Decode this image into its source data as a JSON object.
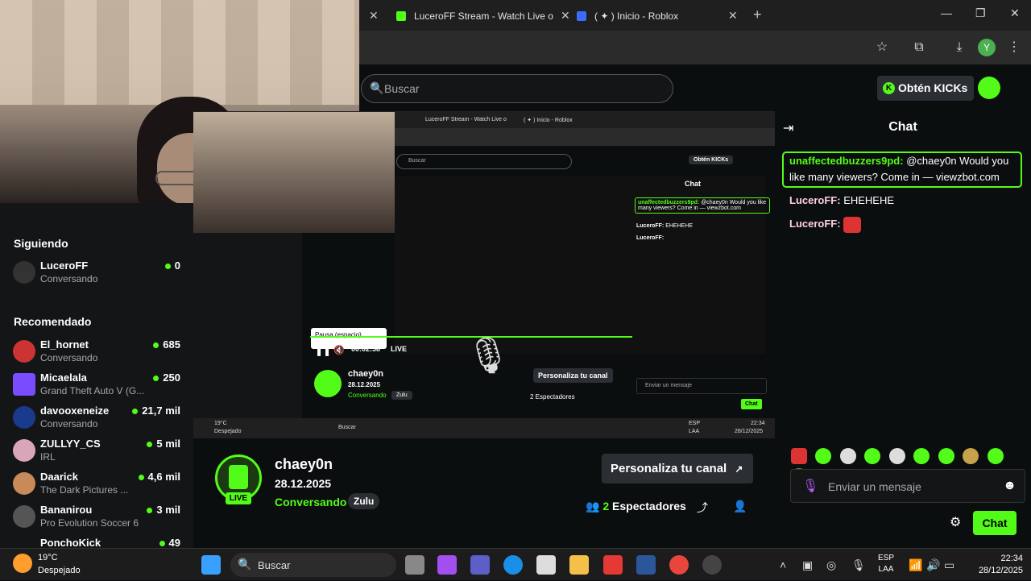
{
  "browser": {
    "tabs": [
      {
        "title": "LuceroFF Stream - Watch Live o",
        "color": "#53fc18"
      },
      {
        "title": "( ✦ ) Inicio - Roblox",
        "color": "#3d6bff"
      }
    ],
    "new_tab": "+",
    "profile_initial": "Y"
  },
  "header": {
    "search_placeholder": "Buscar",
    "kicks_label": "Obtén KICKs"
  },
  "sidebar": {
    "following_title": "Siguiendo",
    "following": [
      {
        "name": "LuceroFF",
        "sub": "Conversando",
        "count": "0"
      }
    ],
    "recommended_title": "Recomendado",
    "recommended": [
      {
        "name": "El_hornet",
        "sub": "Conversando",
        "count": "685"
      },
      {
        "name": "Micaelala",
        "sub": "Grand Theft Auto V (G...",
        "count": "250"
      },
      {
        "name": "davooxeneize",
        "sub": "Conversando",
        "count": "21,7 mil"
      },
      {
        "name": "ZULLYY_CS",
        "sub": "IRL",
        "count": "5 mil"
      },
      {
        "name": "Daarick",
        "sub": "The Dark Pictures ...",
        "count": "4,6 mil"
      },
      {
        "name": "Bananirou",
        "sub": "Pro Evolution Soccer 6",
        "count": "3 mil"
      },
      {
        "name": "PonchoKick",
        "sub": "",
        "count": "49"
      }
    ]
  },
  "nested": {
    "tab1": "LuceroFF Stream - Watch Live o",
    "tab2": "( ✦ ) Inicio - Roblox",
    "search": "Buscar",
    "kicks": "Obtén KICKs",
    "chat_title": "Chat",
    "pause_tooltip": "Pausa (espacio)",
    "time": "00:02:58",
    "live": "LIVE",
    "channel": "chaey0n",
    "date": "28.12.2025",
    "category": "Conversando",
    "tag": "Zulu",
    "customize": "Personaliza tu canal",
    "viewers": "2 Espectadores",
    "chat_placeholder": "Enviar un mensaje",
    "chat_button": "Chat",
    "weather": "19°C",
    "weather_desc": "Despejado",
    "taskbar_search": "Buscar",
    "lang": "ESP",
    "lang2": "LAA",
    "clock_time": "22:34",
    "clock_date": "28/12/2025",
    "msg1_user": "unaffectedbuzzers9pd:",
    "msg1_text": "@chaey0n Would you like many viewers? Come in — viewzbot.com",
    "msg2_user": "LuceroFF:",
    "msg2_text": "EHEHEHE",
    "msg3_user": "LuceroFF:"
  },
  "stream": {
    "live_badge": "LIVE",
    "channel_name": "chaey0n",
    "date": "28.12.2025",
    "category": "Conversando",
    "tag": "Zulu",
    "customize_button": "Personaliza tu canal",
    "viewer_count": "2",
    "viewer_label": "Espectadores"
  },
  "chat": {
    "title": "Chat",
    "messages": [
      {
        "user": "unaffectedbuzzers9pd:",
        "text": "@chaey0n Would you like many viewers? Come in — viewzbot.com",
        "pinned": true
      },
      {
        "user": "LuceroFF:",
        "text": "EHEHEHE"
      },
      {
        "user": "LuceroFF:",
        "text": ""
      }
    ],
    "input_placeholder": "Enviar un mensaje",
    "send_button": "Chat"
  },
  "taskbar": {
    "weather_temp": "19°C",
    "weather_desc": "Despejado",
    "search_placeholder": "Buscar",
    "lang_top": "ESP",
    "lang_bottom": "LAA",
    "time": "22:34",
    "date": "28/12/2025"
  }
}
